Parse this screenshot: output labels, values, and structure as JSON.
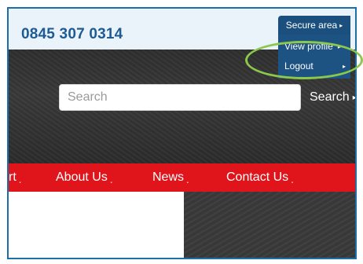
{
  "header": {
    "phone": "0845 307 0314"
  },
  "account_menu": {
    "secure_label": "Secure area",
    "items": [
      {
        "label": "View profile"
      },
      {
        "label": "Logout"
      }
    ]
  },
  "search": {
    "placeholder": "Search",
    "button_label": "Search"
  },
  "nav": {
    "items": [
      {
        "label": "rt"
      },
      {
        "label": "About Us"
      },
      {
        "label": "News"
      },
      {
        "label": "Contact Us"
      }
    ]
  },
  "colors": {
    "nav_red": "#e0141b",
    "brand_blue": "#1c5b94",
    "menu_blue": "#1c5382",
    "highlight_green": "#8cc84b",
    "frame_blue": "#1e6ea6"
  }
}
